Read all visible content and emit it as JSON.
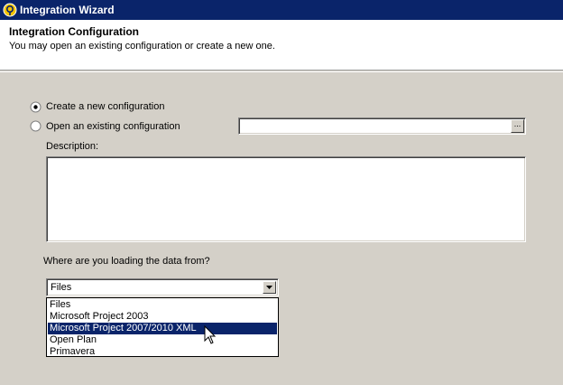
{
  "window": {
    "title": "Integration Wizard"
  },
  "header": {
    "title": "Integration Configuration",
    "subtitle": "You may open an existing configuration or create a new one."
  },
  "options": {
    "create_new": {
      "label": "Create a new configuration",
      "checked": true
    },
    "open_existing": {
      "label": "Open an existing configuration",
      "checked": false
    },
    "browse_label": "..."
  },
  "description": {
    "label": "Description:",
    "value": ""
  },
  "source": {
    "label": "Where are you loading the data from?",
    "selected": "Files",
    "options": [
      "Files",
      "Microsoft Project 2003",
      "Microsoft Project 2007/2010 XML",
      "Open Plan",
      "Primavera"
    ],
    "highlighted_index": 2
  },
  "colors": {
    "titlebar": "#0a246a",
    "highlight": "#0a246a",
    "face": "#d4d0c8"
  }
}
